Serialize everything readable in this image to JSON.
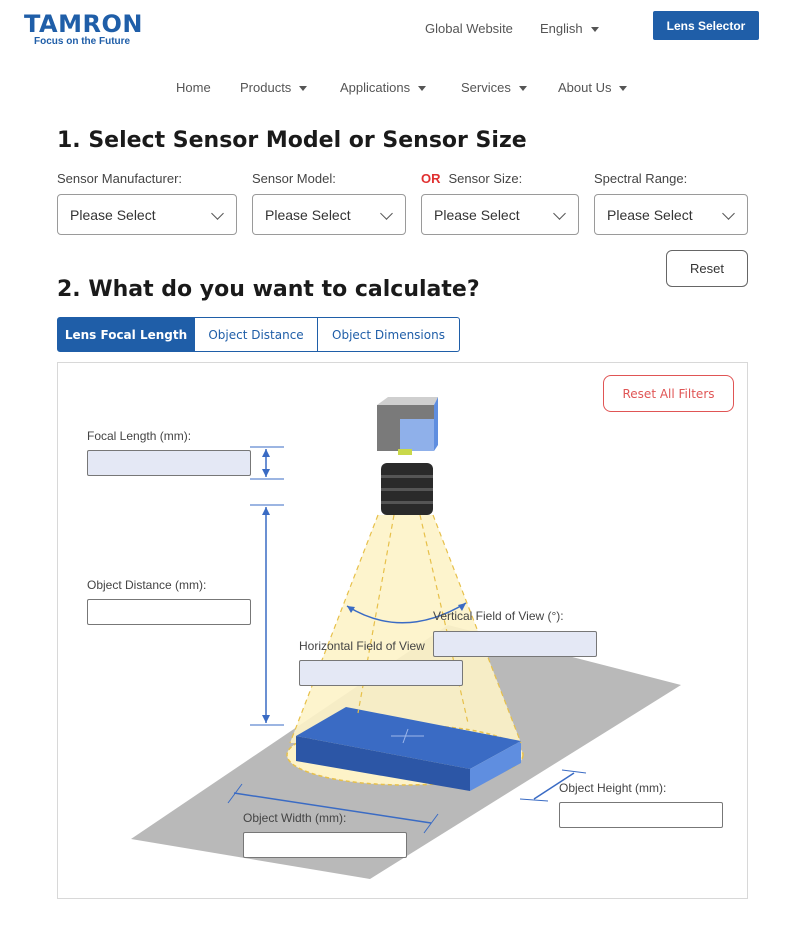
{
  "header": {
    "logo_text": "TAMRON",
    "logo_tagline": "Focus on the Future",
    "global_website": "Global Website",
    "language": "English",
    "lens_selector": "Lens Selector"
  },
  "nav": {
    "items": [
      "Home",
      "Products",
      "Applications",
      "Services",
      "About Us"
    ]
  },
  "section1": {
    "title": "1. Select Sensor Model or Sensor Size",
    "fields": [
      {
        "label": "Sensor Manufacturer:",
        "value": "Please Select"
      },
      {
        "label": "Sensor Model:",
        "value": "Please Select"
      },
      {
        "label": "Sensor Size:",
        "value": "Please Select"
      },
      {
        "label": "Spectral Range:",
        "value": "Please Select"
      }
    ],
    "or_label": "OR",
    "reset": "Reset"
  },
  "section2": {
    "title": "2. What do you want to calculate?",
    "tabs": [
      "Lens Focal Length",
      "Object Distance",
      "Object Dimensions"
    ],
    "active_tab": "Lens Focal Length"
  },
  "calculator": {
    "reset_all_filters": "Reset All Filters",
    "focal_length_label": "Focal Length (mm):",
    "object_distance_label": "Object Distance (mm):",
    "vertical_fov_label": "Vertical Field of View (°):",
    "horizontal_fov_label": "Horizontal Field of View",
    "object_height_label": "Object Height (mm):",
    "object_width_label": "Object Width (mm):",
    "focal_length_value": "",
    "object_distance_value": "",
    "vertical_fov_value": "",
    "horizontal_fov_value": "",
    "object_height_value": "",
    "object_width_value": ""
  },
  "colors": {
    "brand_blue": "#1f5ea8",
    "or_red": "#e03030",
    "reset_filters_red": "#e05555",
    "readonly_field": "#e4e8f5",
    "object_blue": "#3a6bc4",
    "ground_gray": "#b9b9b9",
    "cone_yellow": "#fdf3c8"
  }
}
